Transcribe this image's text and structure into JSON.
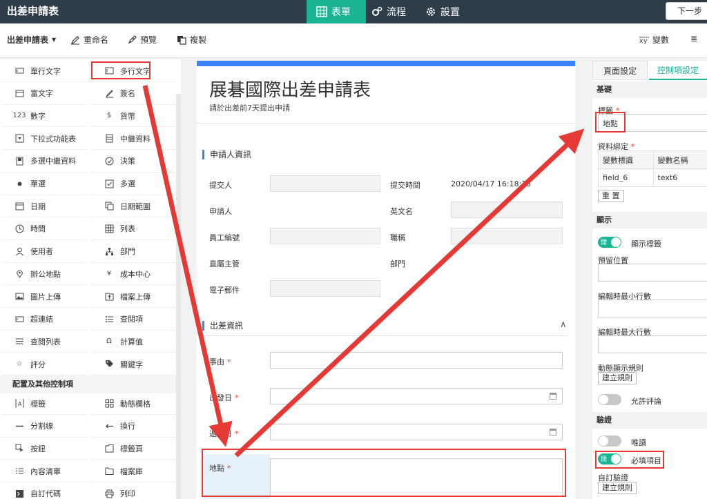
{
  "app_title": "出差申請表",
  "tabs": [
    {
      "label": "表單",
      "icon": "table-icon",
      "active": true
    },
    {
      "label": "流程",
      "icon": "cogs-icon",
      "active": false
    },
    {
      "label": "設置",
      "icon": "gear-icon",
      "active": false
    }
  ],
  "next_button": "下一步",
  "toolbar": {
    "form_name": "出差申請表",
    "rename": "重命名",
    "preview": "預覽",
    "copy": "複製",
    "variables": "變數",
    "right_cut": "≣"
  },
  "palette": {
    "items": [
      {
        "label": "單行文字",
        "icon": "single-line-text-icon"
      },
      {
        "label": "多行文字",
        "icon": "multi-line-text-icon"
      },
      {
        "label": "富文字",
        "icon": "rich-text-icon"
      },
      {
        "label": "簽名",
        "icon": "signature-icon"
      },
      {
        "label": "數字",
        "icon": "number-icon",
        "glyph": "123"
      },
      {
        "label": "貨幣",
        "icon": "currency-icon",
        "glyph": "$"
      },
      {
        "label": "下拉式功能表",
        "icon": "dropdown-icon"
      },
      {
        "label": "中繼資料",
        "icon": "metadata-icon"
      },
      {
        "label": "多選中繼資料",
        "icon": "multi-metadata-icon"
      },
      {
        "label": "決策",
        "icon": "decision-icon"
      },
      {
        "label": "單選",
        "icon": "radio-icon"
      },
      {
        "label": "多選",
        "icon": "checkbox-icon"
      },
      {
        "label": "日期",
        "icon": "calendar-icon"
      },
      {
        "label": "日期範圍",
        "icon": "date-range-icon"
      },
      {
        "label": "時間",
        "icon": "clock-icon"
      },
      {
        "label": "列表",
        "icon": "grid-icon"
      },
      {
        "label": "使用者",
        "icon": "user-icon"
      },
      {
        "label": "部門",
        "icon": "org-icon"
      },
      {
        "label": "辦公地點",
        "icon": "location-icon"
      },
      {
        "label": "成本中心",
        "icon": "yen-icon",
        "glyph": "¥"
      },
      {
        "label": "圖片上傳",
        "icon": "image-upload-icon"
      },
      {
        "label": "檔案上傳",
        "icon": "file-upload-icon"
      },
      {
        "label": "超連結",
        "icon": "link-icon"
      },
      {
        "label": "查閱項",
        "icon": "lookup-icon"
      },
      {
        "label": "查閱列表",
        "icon": "lookup-list-icon"
      },
      {
        "label": "計算值",
        "icon": "omega-icon",
        "glyph": "Ω"
      },
      {
        "label": "評分",
        "icon": "star-icon",
        "glyph": "☆"
      },
      {
        "label": "關鍵字",
        "icon": "tag-icon"
      }
    ],
    "section_title": "配置及其他控制項",
    "items2": [
      {
        "label": "標籤",
        "icon": "label-icon"
      },
      {
        "label": "動態欄格",
        "icon": "dynamic-grid-icon"
      },
      {
        "label": "分割線",
        "icon": "divider-icon"
      },
      {
        "label": "換行",
        "icon": "line-break-icon"
      },
      {
        "label": "按鈕",
        "icon": "button-icon"
      },
      {
        "label": "標籤頁",
        "icon": "tab-page-icon"
      },
      {
        "label": "內容清單",
        "icon": "content-list-icon"
      },
      {
        "label": "檔案庫",
        "icon": "folder-icon"
      },
      {
        "label": "自訂代碼",
        "icon": "code-icon"
      },
      {
        "label": "列印",
        "icon": "print-icon"
      }
    ]
  },
  "form": {
    "title": "展碁國際出差申請表",
    "subtitle": "請於出差前7天提出申請",
    "section1": "申請人資訊",
    "submitter": "提交人",
    "submit_time_label": "提交時間",
    "submit_time_value": "2020/04/17 16:18:15",
    "applicant": "申請人",
    "english_name": "英文名",
    "employee_id": "員工編號",
    "job_title": "職稱",
    "supervisor": "直屬主管",
    "department": "部門",
    "email": "電子郵件",
    "section2": "出差資訊",
    "reason": "事由",
    "depart_date": "出發日",
    "return_date": "返回日",
    "place": "地點",
    "required_mark": "*",
    "collapse_glyph": "∧"
  },
  "right_panel": {
    "tab_page": "頁面設定",
    "tab_control": "控制項設定",
    "basic": "基礎",
    "label_title": "標籤",
    "label_value": "地點",
    "binding": "資料綁定",
    "col_var_id": "變數標識",
    "col_var_name": "變數名稱",
    "field_id": "field_6",
    "field_name": "text6",
    "reset": "重 置",
    "display": "顯示",
    "toggle_on": "開",
    "show_label": "顯示標籤",
    "placeholder": "預留位置",
    "min_rows": "編輯時最小行數",
    "max_rows": "編輯時最大行數",
    "dynamic_rule": "動態顯示規則",
    "create_rule": "建立規則",
    "allow_comment": "允許評論",
    "validation": "驗證",
    "readonly": "唯讀",
    "required": "必填項目",
    "custom_validation": "自訂驗證",
    "create_rule2": "建立規則"
  },
  "colors": {
    "topbar": "#2f3d49",
    "accent": "#1bb394",
    "blue": "#3b82f6",
    "annotation": "#e53935"
  }
}
